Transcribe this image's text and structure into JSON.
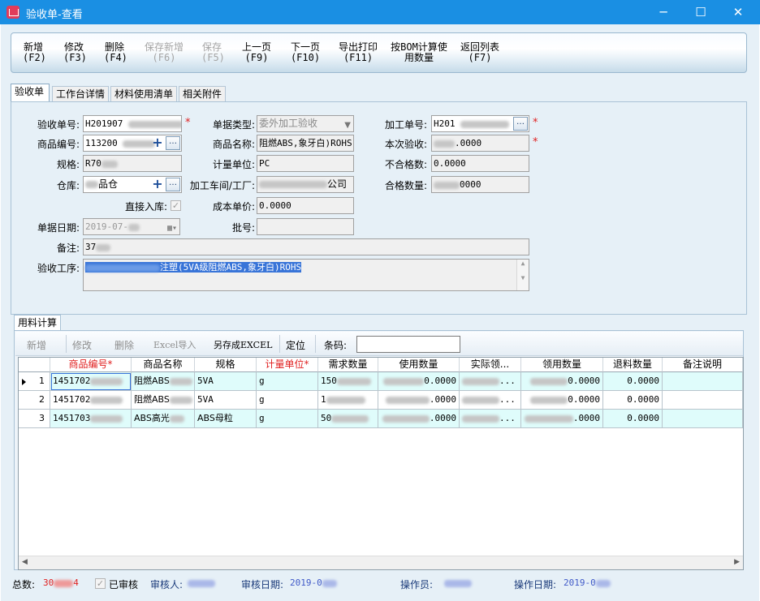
{
  "window": {
    "title": "验收单-查看",
    "controls": [
      "─",
      "☐",
      "✕"
    ]
  },
  "toolbar": [
    {
      "label": "新增",
      "key": "(F2)",
      "enabled": true
    },
    {
      "label": "修改",
      "key": "(F3)",
      "enabled": true
    },
    {
      "label": "删除",
      "key": "(F4)",
      "enabled": true
    },
    {
      "label": "保存新增",
      "key": "(F6)",
      "enabled": false
    },
    {
      "label": "保存",
      "key": "(F5)",
      "enabled": false
    },
    {
      "label": "上一页",
      "key": "(F9)",
      "enabled": true
    },
    {
      "label": "下一页",
      "key": "(F10)",
      "enabled": true
    },
    {
      "label": "导出打印",
      "key": "(F11)",
      "enabled": true
    },
    {
      "label": "按BOM计算使",
      "key": "用数量",
      "enabled": true
    },
    {
      "label": "返回列表",
      "key": "(F7)",
      "enabled": true
    }
  ],
  "tabs": [
    "验收单",
    "工作台详情",
    "材料使用清单",
    "相关附件"
  ],
  "form": {
    "doc_no": {
      "label": "验收单号:",
      "value": "H201907"
    },
    "doc_type": {
      "label": "单据类型:",
      "value": "委外加工验收"
    },
    "process_no": {
      "label": "加工单号:",
      "value": "H201"
    },
    "product_code": {
      "label": "商品编号:",
      "value": "113200"
    },
    "product_name": {
      "label": "商品名称:",
      "value": "阻燃ABS,象牙白)ROHS"
    },
    "this_accept": {
      "label": "本次验收:",
      "value": ".0000"
    },
    "spec": {
      "label": "规格:",
      "value": "R70"
    },
    "unit": {
      "label": "计量单位:",
      "value": "PC"
    },
    "unqualified": {
      "label": "不合格数:",
      "value": "0.0000"
    },
    "warehouse": {
      "label": "仓库:",
      "value": "品仓"
    },
    "workshop": {
      "label": "加工车间/工厂:",
      "value": "公司"
    },
    "qualified": {
      "label": "合格数量:",
      "value": "0000"
    },
    "direct_in": {
      "label": "直接入库:",
      "checked": true
    },
    "cost_price": {
      "label": "成本单价:",
      "value": "0.0000"
    },
    "doc_date": {
      "label": "单据日期:",
      "value": "2019-07-"
    },
    "batch": {
      "label": "批号:",
      "value": ""
    },
    "remark": {
      "label": "备注:",
      "value": "37"
    },
    "accept_process": {
      "label": "验收工序:",
      "value": "注塑(5VA级阻燃ABS,象牙白)ROHS"
    }
  },
  "calc": {
    "tab": "用料计算",
    "toolbar": [
      {
        "label": "新增",
        "enabled": false
      },
      {
        "label": "修改",
        "enabled": false
      },
      {
        "label": "删除",
        "enabled": false
      },
      {
        "label": "Excel导入",
        "enabled": false
      },
      {
        "label": "另存成EXCEL",
        "enabled": true
      },
      {
        "label": "定位",
        "enabled": true
      }
    ],
    "barcode_label": "条码:",
    "barcode_value": "",
    "columns": [
      {
        "label": "商品编号*",
        "required": true
      },
      {
        "label": "商品名称",
        "required": false
      },
      {
        "label": "规格",
        "required": false
      },
      {
        "label": "计量单位*",
        "required": true
      },
      {
        "label": "需求数量",
        "required": false
      },
      {
        "label": "使用数量",
        "required": false
      },
      {
        "label": "实际领...",
        "required": false
      },
      {
        "label": "领用数量",
        "required": false
      },
      {
        "label": "退料数量",
        "required": false
      },
      {
        "label": "备注说明",
        "required": false
      }
    ],
    "rows": [
      {
        "no": "1",
        "code": "1451702",
        "name": "阻燃ABS",
        "spec": "5VA",
        "unit": "g",
        "demand": "150",
        "use": "0.0000",
        "actual": "...",
        "receive": "0.0000",
        "return": "0.0000",
        "note": ""
      },
      {
        "no": "2",
        "code": "1451702",
        "name": "阻燃ABS",
        "spec": "5VA",
        "unit": "g",
        "demand": "1",
        "use": ".0000",
        "actual": "...",
        "receive": "0.0000",
        "return": "0.0000",
        "note": ""
      },
      {
        "no": "3",
        "code": "1451703",
        "name": "ABS高光",
        "spec": "ABS母粒",
        "unit": "g",
        "demand": "50",
        "use": ".0000",
        "actual": "...",
        "receive": ".0000",
        "return": "0.0000",
        "note": ""
      }
    ]
  },
  "status": {
    "total_label": "总数:",
    "total_value": "30",
    "total_value_tail": "4",
    "audited_label": "已审核",
    "audited": true,
    "auditor_label": "审核人:",
    "audit_date_label": "审核日期:",
    "audit_date": "2019-0",
    "operator_label": "操作员:",
    "op_date_label": "操作日期:",
    "op_date": "2019-0"
  }
}
